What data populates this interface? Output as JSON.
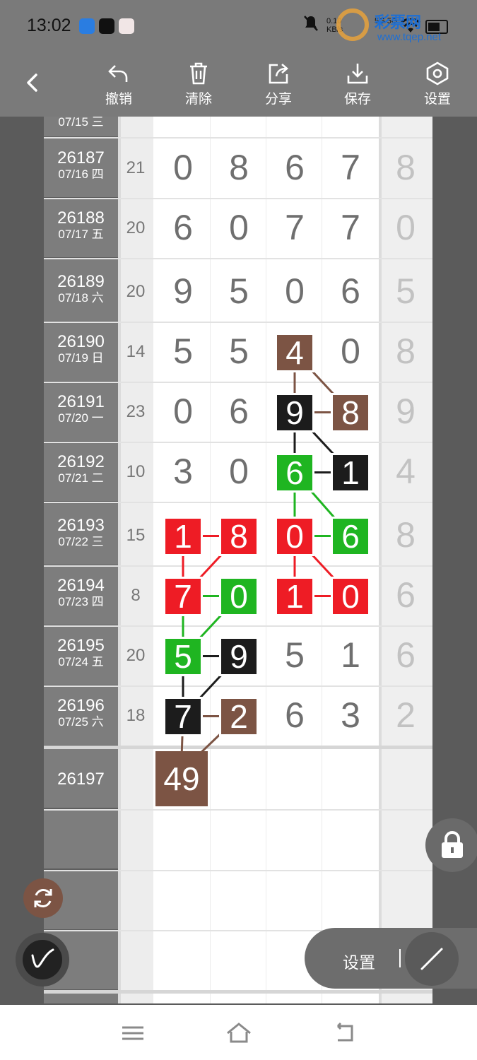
{
  "status_bar": {
    "time": "13:02",
    "net_speed_top": "0.10",
    "net_speed_unit": "KB/s",
    "signal_labels": [
      "5G",
      "5G"
    ],
    "watermark_cn": "彩票网",
    "watermark_url": "www.tqep.net",
    "icons": [
      "messages-app-icon",
      "tiktok-icon",
      "avatar-app-icon",
      "mute-bell-icon",
      "wifi-icon",
      "battery-icon"
    ]
  },
  "toolbar": {
    "back_icon": "chevron-left-icon",
    "buttons": [
      {
        "label": "撤销",
        "icon": "undo-icon"
      },
      {
        "label": "清除",
        "icon": "trash-icon"
      },
      {
        "label": "分享",
        "icon": "share-icon"
      },
      {
        "label": "保存",
        "icon": "download-icon"
      },
      {
        "label": "设置",
        "icon": "settings-hexagon-icon"
      }
    ]
  },
  "table": {
    "partial_top_row": {
      "issue_date": "07/15 三"
    },
    "rows": [
      {
        "issue": "26187",
        "date": "07/16 四",
        "sum": "21",
        "digits": [
          "0",
          "8",
          "6",
          "7"
        ],
        "extra": "8"
      },
      {
        "issue": "26188",
        "date": "07/17 五",
        "sum": "20",
        "digits": [
          "6",
          "0",
          "7",
          "7"
        ],
        "extra": "0"
      },
      {
        "issue": "26189",
        "date": "07/18 六",
        "sum": "20",
        "digits": [
          "9",
          "5",
          "0",
          "6"
        ],
        "extra": "5"
      },
      {
        "issue": "26190",
        "date": "07/19 日",
        "sum": "14",
        "digits": [
          "5",
          "5",
          "4",
          "0"
        ],
        "extra": "8"
      },
      {
        "issue": "26191",
        "date": "07/20 一",
        "sum": "23",
        "digits": [
          "0",
          "6",
          "9",
          "8"
        ],
        "extra": "9"
      },
      {
        "issue": "26192",
        "date": "07/21 二",
        "sum": "10",
        "digits": [
          "3",
          "0",
          "6",
          "1"
        ],
        "extra": "4"
      },
      {
        "issue": "26193",
        "date": "07/22 三",
        "sum": "15",
        "digits": [
          "1",
          "8",
          "0",
          "6"
        ],
        "extra": "8"
      },
      {
        "issue": "26194",
        "date": "07/23 四",
        "sum": "8",
        "digits": [
          "7",
          "0",
          "1",
          "0"
        ],
        "extra": "6"
      },
      {
        "issue": "26195",
        "date": "07/24 五",
        "sum": "20",
        "digits": [
          "5",
          "9",
          "5",
          "1"
        ],
        "extra": "6"
      },
      {
        "issue": "26196",
        "date": "07/25 六",
        "sum": "18",
        "digits": [
          "7",
          "2",
          "6",
          "3"
        ],
        "extra": "2"
      }
    ],
    "next_issue": "26197",
    "prediction_box": "49"
  },
  "floating": {
    "pill_label": "设置",
    "refresh_icon": "refresh-icon",
    "pen_icon": "pen-icon",
    "lock_icon": "lock-icon"
  },
  "colors": {
    "red": "#ee1c25",
    "green": "#1fb521",
    "black": "#1c1c1c",
    "brown": "#7c5444"
  }
}
